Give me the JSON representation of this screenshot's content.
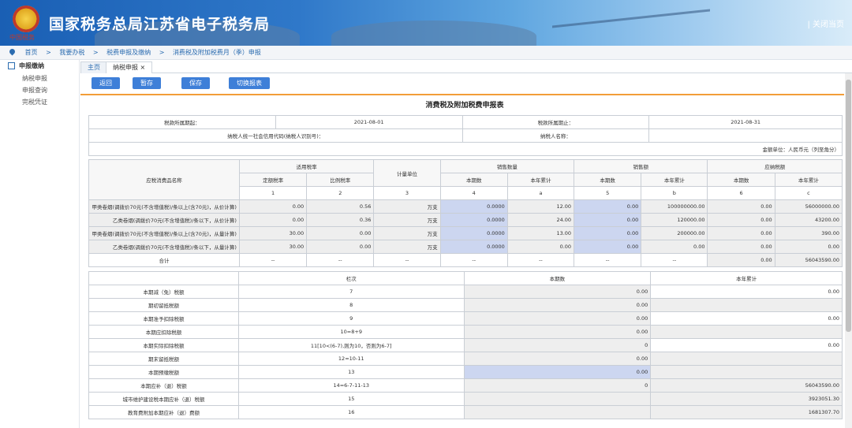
{
  "header": {
    "emblem_text": "中国税务",
    "site_title": "国家税务总局江苏省电子税务局",
    "close_link": "| 关闭当页"
  },
  "breadcrumb": [
    "首页",
    ">",
    "我要办税",
    ">",
    "税费申报及缴纳",
    ">",
    "消费税及附加税费月（季）申报"
  ],
  "sidebar": {
    "title": "申报缴纳",
    "items": [
      "纳税申报",
      "申报查询",
      "完税凭证"
    ]
  },
  "tabs": [
    "主页",
    "纳税申报 ×"
  ],
  "toolbar": [
    "返回",
    "暂存",
    "保存",
    "切换报表"
  ],
  "form": {
    "title": "消费税及附加税费申报表",
    "period_start_label": "税款所属期起：",
    "period_start": "2021-08-01",
    "period_end_label": "税款所属期止：",
    "period_end": "2021-08-31",
    "taxpayer_id_label": "纳税人统一社会信用代码(纳税人识别号)：",
    "taxpayer_name_label": "纳税人名称：",
    "unit_note": "金额单位：人民币元（列至角分）"
  },
  "main_table": {
    "headers": {
      "item_name": "应税消费品名称",
      "rate": "适用税率",
      "rate_fixed": "定额税率",
      "rate_pct": "比例税率",
      "unit": "计量单位",
      "qty": "销售数量",
      "amount": "销售额",
      "tax": "应纳税额",
      "current": "本期数",
      "ytd": "本年累计",
      "col_nums": [
        "1",
        "2",
        "3",
        "4",
        "a",
        "5",
        "b",
        "6",
        "c"
      ]
    },
    "rows": [
      {
        "name": "甲类卷烟(调拨价70元(不含增值税)/条以上(含70元)，从价计算)",
        "fixed": "0.00",
        "pct": "0.56",
        "unit": "万支",
        "qty": "0.0000",
        "qty_ytd": "12.00",
        "amt": "0.00",
        "amt_ytd": "100000000.00",
        "tax": "0.00",
        "tax_ytd": "56000000.00"
      },
      {
        "name": "乙类卷烟(调拨价70元(不含增值税)/条以下，从价计算)",
        "fixed": "0.00",
        "pct": "0.36",
        "unit": "万支",
        "qty": "0.0000",
        "qty_ytd": "24.00",
        "amt": "0.00",
        "amt_ytd": "120000.00",
        "tax": "0.00",
        "tax_ytd": "43200.00"
      },
      {
        "name": "甲类卷烟(调拨价70元(不含增值税)/条以上(含70元)，从量计算)",
        "fixed": "30.00",
        "pct": "0.00",
        "unit": "万支",
        "qty": "0.0000",
        "qty_ytd": "13.00",
        "amt": "0.00",
        "amt_ytd": "200000.00",
        "tax": "0.00",
        "tax_ytd": "390.00"
      },
      {
        "name": "乙类卷烟(调拨价70元(不含增值税)/条以下，从量计算)",
        "fixed": "30.00",
        "pct": "0.00",
        "unit": "万支",
        "qty": "0.0000",
        "qty_ytd": "0.00",
        "amt": "0.00",
        "amt_ytd": "0.00",
        "tax": "0.00",
        "tax_ytd": "0.00"
      }
    ],
    "total": {
      "name": "合计",
      "dash": "--",
      "tax": "0.00",
      "tax_ytd": "56043590.00"
    }
  },
  "lower_table": {
    "headers": {
      "col1": "",
      "col2": "栏次",
      "col3": "本期数",
      "col4": "本年累计"
    },
    "rows": [
      {
        "name": "本期减（免）税额",
        "line": "7",
        "current": "0.00",
        "ytd": "0.00"
      },
      {
        "name": "期初留抵税额",
        "line": "8",
        "current": "0.00",
        "ytd": ""
      },
      {
        "name": "本期准予扣除税额",
        "line": "9",
        "current": "0.00",
        "ytd": "0.00"
      },
      {
        "name": "本期应扣除税额",
        "line": "10=8+9",
        "current": "0.00",
        "ytd": ""
      },
      {
        "name": "本期实际扣除税额",
        "line": "11[10<(6-7),则为10，否则为6-7]",
        "current": "0",
        "ytd": "0.00"
      },
      {
        "name": "期末留抵税额",
        "line": "12=10-11",
        "current": "0.00",
        "ytd": ""
      },
      {
        "name": "本期预缴税额",
        "line": "13",
        "current": "0.00",
        "ytd": ""
      },
      {
        "name": "本期应补（退）税额",
        "line": "14=6-7-11-13",
        "current": "0",
        "ytd": "56043590.00"
      },
      {
        "name": "城市维护建设税本期应补（退）税额",
        "line": "15",
        "current": "",
        "ytd": "3923051.30"
      },
      {
        "name": "教育费附加本期应补（退）费额",
        "line": "16",
        "current": "",
        "ytd": "1681307.70"
      }
    ]
  }
}
